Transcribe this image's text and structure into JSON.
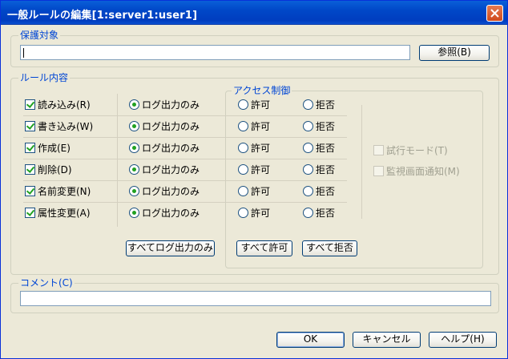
{
  "window": {
    "title": "一般ルールの編集[1:server1:user1]",
    "close_label": "×"
  },
  "target_group": {
    "label": "保護対象",
    "path_value": "",
    "browse_button": "参照(B)"
  },
  "rule_group": {
    "label": "ルール内容",
    "access_label": "アクセス制御",
    "rows": [
      {
        "name": "読み込み(R)",
        "checked": true,
        "log": "ログ出力のみ",
        "allow": "許可",
        "deny": "拒否"
      },
      {
        "name": "書き込み(W)",
        "checked": true,
        "log": "ログ出力のみ",
        "allow": "許可",
        "deny": "拒否"
      },
      {
        "name": "作成(E)",
        "checked": true,
        "log": "ログ出力のみ",
        "allow": "許可",
        "deny": "拒否"
      },
      {
        "name": "削除(D)",
        "checked": true,
        "log": "ログ出力のみ",
        "allow": "許可",
        "deny": "拒否"
      },
      {
        "name": "名前変更(N)",
        "checked": true,
        "log": "ログ出力のみ",
        "allow": "許可",
        "deny": "拒否"
      },
      {
        "name": "属性変更(A)",
        "checked": true,
        "log": "ログ出力のみ",
        "allow": "許可",
        "deny": "拒否"
      }
    ],
    "trial_mode": "試行モード(T)",
    "monitor_notify": "監視画面通知(M)",
    "all_log_button": "すべてログ出力のみ",
    "all_allow_button": "すべて許可",
    "all_deny_button": "すべて拒否"
  },
  "comment_group": {
    "label": "コメント(C)",
    "value": ""
  },
  "footer": {
    "ok": "OK",
    "cancel": "キャンセル",
    "help": "ヘルプ(H)"
  },
  "colors": {
    "title_bar": "#0048c8",
    "group_label": "#0046d5",
    "dialog_bg": "#ece9d8"
  }
}
